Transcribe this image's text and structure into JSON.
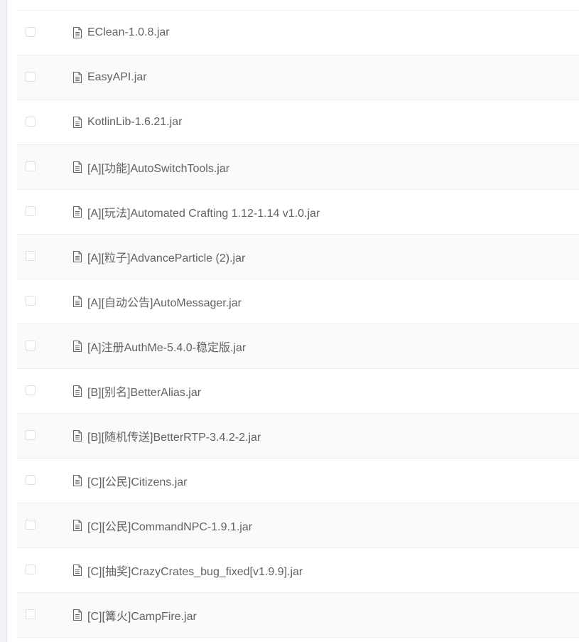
{
  "file_list": {
    "icon": "document-icon",
    "rows": [
      {
        "name": "EClean-1.0.8.jar",
        "selected": false
      },
      {
        "name": "EasyAPI.jar",
        "selected": false
      },
      {
        "name": "KotlinLib-1.6.21.jar",
        "selected": false
      },
      {
        "name": "[A][功能]AutoSwitchTools.jar",
        "selected": false
      },
      {
        "name": "[A][玩法]Automated Crafting 1.12-1.14 v1.0.jar",
        "selected": false
      },
      {
        "name": "[A][粒子]AdvanceParticle (2).jar",
        "selected": false
      },
      {
        "name": "[A][自动公告]AutoMessager.jar",
        "selected": false
      },
      {
        "name": "[A]注册AuthMe-5.4.0-稳定版.jar",
        "selected": false
      },
      {
        "name": "[B][别名]BetterAlias.jar",
        "selected": false
      },
      {
        "name": "[B][随机传送]BetterRTP-3.4.2-2.jar",
        "selected": false
      },
      {
        "name": "[C][公民]Citizens.jar",
        "selected": false
      },
      {
        "name": "[C][公民]CommandNPC-1.9.1.jar",
        "selected": false
      },
      {
        "name": "[C][抽奖]CrazyCrates_bug_fixed[v1.9.9].jar",
        "selected": false
      },
      {
        "name": "[C][篝火]CampFire.jar",
        "selected": false
      }
    ]
  }
}
